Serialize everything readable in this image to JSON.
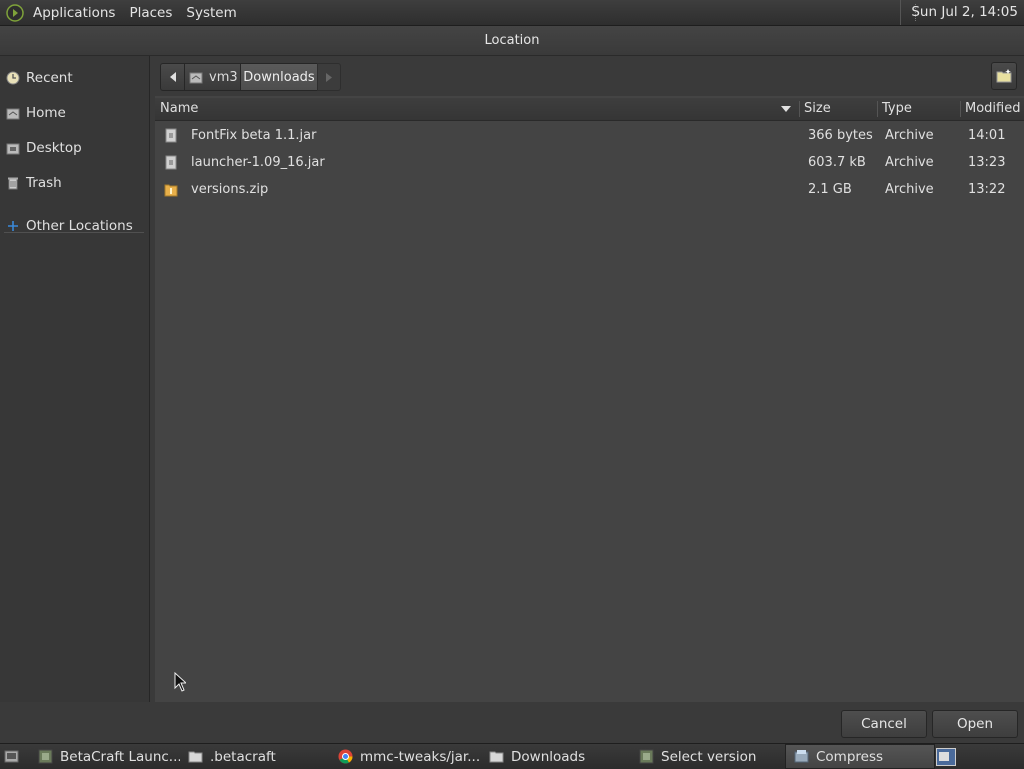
{
  "top_panel": {
    "menus": [
      "Applications",
      "Places",
      "System"
    ],
    "clock": "Sun Jul  2, 14:05"
  },
  "dialog": {
    "title": "Location",
    "sidebar": {
      "items": [
        {
          "label": "Recent",
          "icon": "recent-icon"
        },
        {
          "label": "Home",
          "icon": "home-icon"
        },
        {
          "label": "Desktop",
          "icon": "desktop-icon"
        },
        {
          "label": "Trash",
          "icon": "trash-icon"
        },
        {
          "label": "Other Locations",
          "icon": "plus-icon"
        }
      ]
    },
    "pathbar": {
      "segments": [
        "vm3",
        "Downloads"
      ]
    },
    "columns": [
      "Name",
      "Size",
      "Type",
      "Modified"
    ],
    "files": [
      {
        "name": "FontFix beta 1.1.jar",
        "size": "366 bytes",
        "type": "Archive",
        "modified": "14:01",
        "icon": "jar-file-icon"
      },
      {
        "name": "launcher-1.09_16.jar",
        "size": "603.7 kB",
        "type": "Archive",
        "modified": "13:23",
        "icon": "jar-file-icon"
      },
      {
        "name": "versions.zip",
        "size": "2.1 GB",
        "type": "Archive",
        "modified": "13:22",
        "icon": "zip-file-icon"
      }
    ],
    "buttons": {
      "cancel": "Cancel",
      "open": "Open"
    }
  },
  "taskbar": {
    "tasks": [
      {
        "label": "BetaCraft Launc...",
        "icon": "java-app-icon",
        "active": false
      },
      {
        "label": ".betacraft",
        "icon": "folder-icon",
        "active": false
      },
      {
        "label": "mmc-tweaks/jar...",
        "icon": "chrome-icon",
        "active": false
      },
      {
        "label": "Downloads",
        "icon": "folder-icon",
        "active": false
      },
      {
        "label": "Select version",
        "icon": "java-app-icon",
        "active": false
      },
      {
        "label": "Compress",
        "icon": "archive-manager-icon",
        "active": true
      }
    ]
  },
  "colors": {
    "background": "#3c3c3c",
    "accent": "#3a89d8",
    "folder": "#e8b04a"
  }
}
